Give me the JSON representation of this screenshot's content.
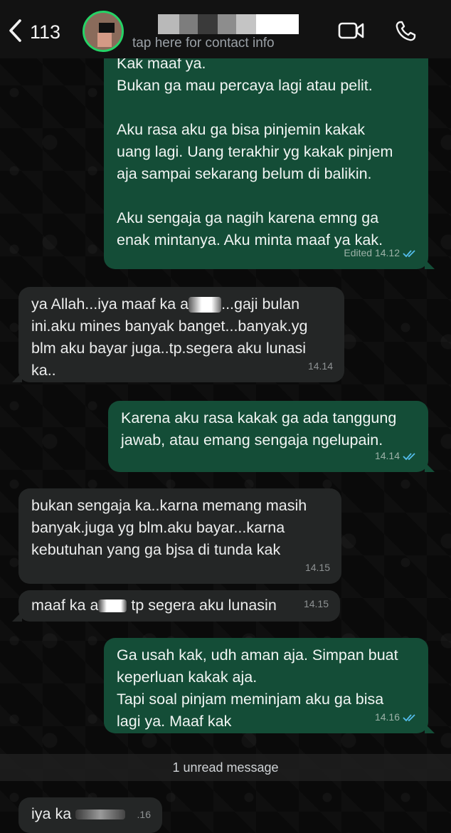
{
  "header": {
    "back_count": "113",
    "contact_info": "tap here for contact info",
    "accent_color": "#25d366"
  },
  "icons": {
    "back": "chevron-left-icon",
    "video": "video-call-icon",
    "phone": "phone-icon",
    "read": "double-check-icon"
  },
  "messages": [
    {
      "direction": "out",
      "text": "Kak maaf ya.\nBukan ga mau percaya lagi atau pelit.\n\nAku rasa aku ga bisa pinjemin kakak\nuang lagi. Uang terakhir yg kakak pinjem\naja sampai sekarang belum di balikin.\n\nAku sengaja ga nagih karena emng ga\nenak mintanya. Aku minta maaf ya kak.",
      "time": "Edited 14.12"
    },
    {
      "direction": "in",
      "text_before": "ya Allah...iya maaf ka a",
      "text_after": "...gaji bulan\nini.aku mines banyak banget...banyak.yg\nblm aku bayar juga..tp.segera aku lunasi\nka..",
      "time": "14.14"
    },
    {
      "direction": "out",
      "text": "Karena aku rasa kakak ga ada tanggung\njawab, atau emang sengaja ngelupain.",
      "time": "14.14"
    },
    {
      "direction": "in",
      "text": "bukan sengaja ka..karna memang masih\nbanyak.juga yg blm.aku bayar...karna\nkebutuhan yang ga bjsa di tunda kak",
      "time": "14.15"
    },
    {
      "direction": "in",
      "text_before": "maaf ka a",
      "text_after": " tp segera aku lunasin",
      "time": "14.15"
    },
    {
      "direction": "out",
      "text": "Ga usah kak, udh aman aja. Simpan buat\nkeperluan kakak aja.\nTapi soal pinjam meminjam aku ga bisa\nlagi ya. Maaf kak",
      "time": "14.16"
    },
    {
      "direction": "in",
      "text_before": "iya ka",
      "time": ".16"
    }
  ],
  "unread_label": "1 unread message"
}
